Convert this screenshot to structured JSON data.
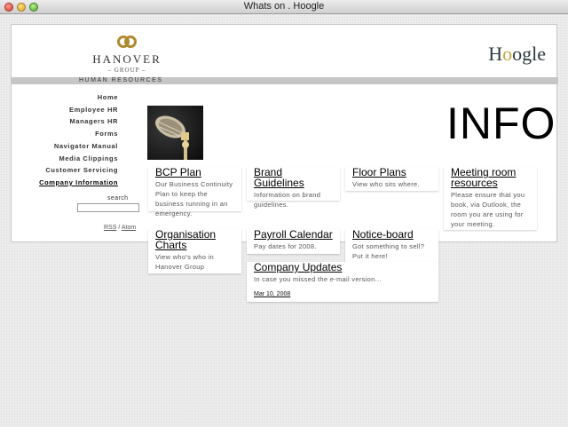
{
  "window": {
    "title": "Whats on . Hoogle"
  },
  "header": {
    "brand_name": "HANOVER",
    "brand_sub": "– GROUP –",
    "hoogle_h": "H",
    "hoogle_o1": "o",
    "hoogle_rest": "ogle",
    "section": "HUMAN RESOURCES"
  },
  "nav": {
    "items": [
      {
        "label": "Home"
      },
      {
        "label": "Employee HR"
      },
      {
        "label": "Managers HR"
      },
      {
        "label": "Forms"
      },
      {
        "label": "Navigator Manual"
      },
      {
        "label": "Media Clippings"
      },
      {
        "label": "Customer Servicing"
      },
      {
        "label": "Company Information"
      }
    ]
  },
  "search": {
    "label": "search",
    "value": ""
  },
  "feeds": {
    "rss": "RSS",
    "separator": " / ",
    "atom": "Atom"
  },
  "main": {
    "heading": "INFO",
    "cards": [
      {
        "title": "BCP Plan",
        "desc": "Our Business Continuity Plan to keep the business running in an emergency."
      },
      {
        "title": "Brand Guidelines",
        "desc": "Information on brand guidelines."
      },
      {
        "title": "Floor Plans",
        "desc": "View who sits where."
      },
      {
        "title": "Meeting room resources",
        "desc": "Please ensure that you book, via Outlook, the room you are using for your meeting."
      },
      {
        "title": "Organisation Charts",
        "desc": "View who's who in Hanover Group"
      },
      {
        "title": "Payroll Calendar",
        "desc": "Pay dates for 2008."
      },
      {
        "title": "Notice-board",
        "desc": "Got something to sell? Put it here!"
      },
      {
        "title": "Company Updates",
        "desc": "In case you missed the e-mail version...",
        "date": "Mar 10, 2008"
      }
    ]
  },
  "colors": {
    "gold": "#c9a23a",
    "bar": "#c6c6c6"
  }
}
